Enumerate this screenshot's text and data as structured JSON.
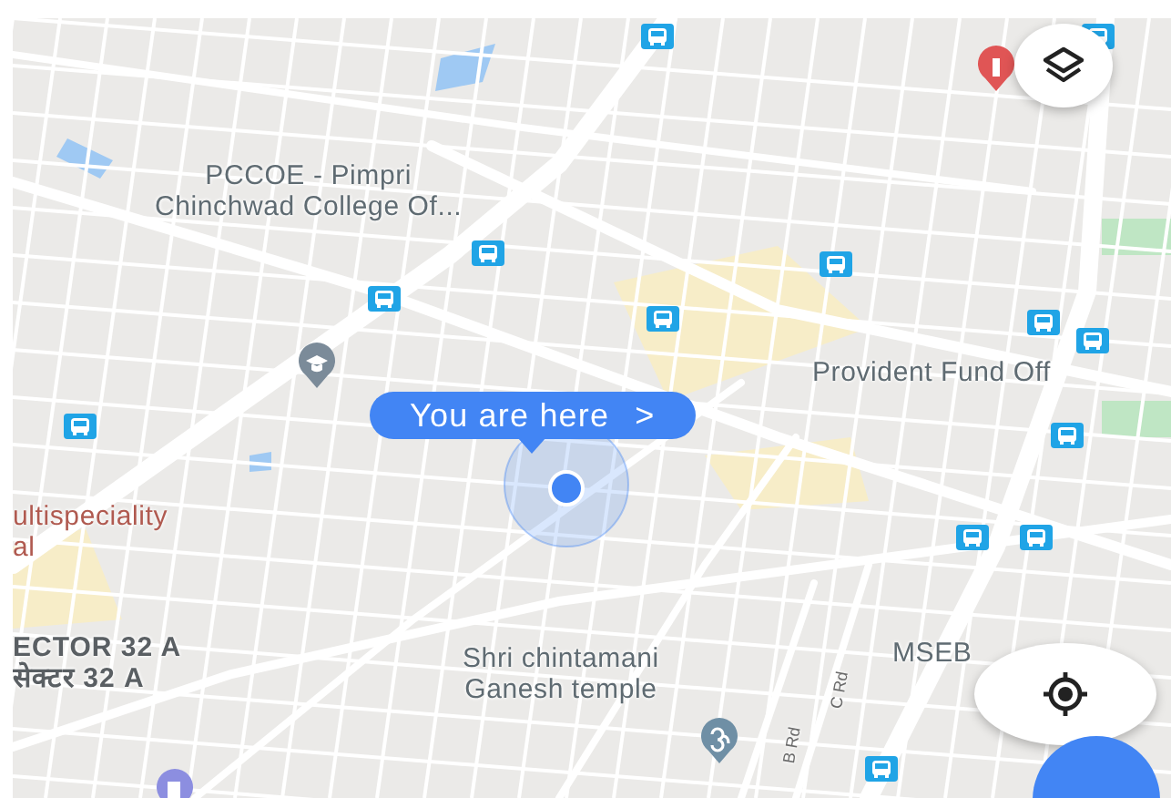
{
  "map": {
    "labels": [
      {
        "kind": "place",
        "lines": [
          "PCCOE - Pimpri",
          "Chinchwad College Of..."
        ]
      },
      {
        "kind": "place",
        "lines": [
          "Provident Fund Off"
        ]
      },
      {
        "kind": "hospital",
        "lines": [
          "ultispeciality",
          "al"
        ]
      },
      {
        "kind": "area",
        "lines": [
          "ECTOR 32 A",
          "सेक्टर 32 A"
        ]
      },
      {
        "kind": "place",
        "lines": [
          "Shri chintamani",
          "Ganesh temple"
        ]
      },
      {
        "kind": "place",
        "lines": [
          "MSEB"
        ]
      },
      {
        "kind": "road",
        "lines": [
          "C Rd"
        ]
      },
      {
        "kind": "road",
        "lines": [
          "B Rd"
        ]
      }
    ]
  },
  "location_callout": {
    "text": "You are here",
    "chevron": ">"
  }
}
